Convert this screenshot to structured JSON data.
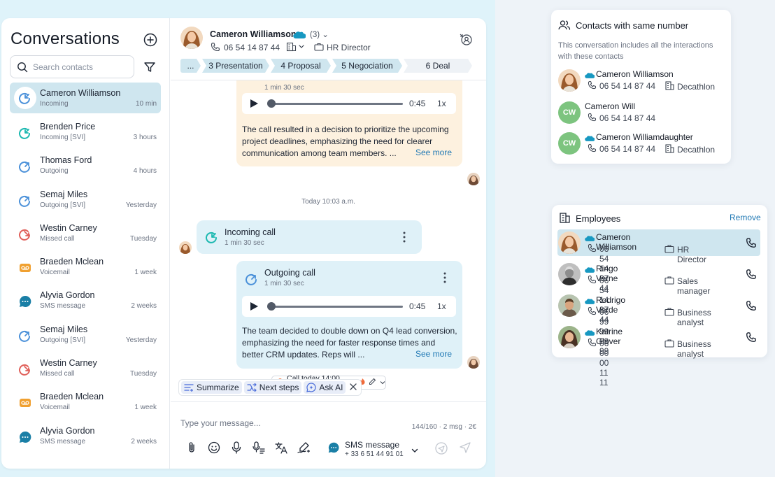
{
  "sidebar": {
    "title": "Conversations",
    "search_placeholder": "Search contacts",
    "conversations": [
      {
        "name": "Cameron Williamson",
        "type": "Incoming",
        "time": "10 min",
        "icon": "incoming-call-icon",
        "active": true
      },
      {
        "name": "Brenden Price",
        "type": "Incoming [SVI]",
        "time": "3 hours",
        "icon": "incoming-call-icon"
      },
      {
        "name": "Thomas Ford",
        "type": "Outgoing",
        "time": "4 hours",
        "icon": "outgoing-call-icon"
      },
      {
        "name": "Semaj Miles",
        "type": "Outgoing [SVI]",
        "time": "Yesterday",
        "icon": "outgoing-call-icon"
      },
      {
        "name": "Westin Carney",
        "type": "Missed call",
        "time": "Tuesday",
        "icon": "missed-call-icon"
      },
      {
        "name": "Braeden Mclean",
        "type": "Voicemail",
        "time": "1 week",
        "icon": "voicemail-icon"
      },
      {
        "name": "Alyvia Gordon",
        "type": "SMS message",
        "time": "2 weeks",
        "icon": "sms-icon"
      },
      {
        "name": "Semaj Miles",
        "type": "Outgoing [SVI]",
        "time": "Yesterday",
        "icon": "outgoing-call-icon"
      },
      {
        "name": "Westin Carney",
        "type": "Missed call",
        "time": "Tuesday",
        "icon": "missed-call-icon"
      },
      {
        "name": "Braeden Mclean",
        "type": "Voicemail",
        "time": "1 week",
        "icon": "voicemail-icon"
      },
      {
        "name": "Alyvia Gordon",
        "type": "SMS message",
        "time": "2 weeks",
        "icon": "sms-icon"
      }
    ]
  },
  "header": {
    "name": "Cameron Williamson",
    "count": "(3)",
    "phone": "06 54 14 87 44",
    "role": "HR Director",
    "pipeline": [
      {
        "label": "..."
      },
      {
        "label": "3 Presentation"
      },
      {
        "label": "4 Proposal"
      },
      {
        "label": "5 Negociation"
      },
      {
        "label": "6 Deal"
      }
    ]
  },
  "chat": {
    "first_call": {
      "duration": "1 min 30 sec",
      "time": "0:45",
      "speed": "1x",
      "summary": "The call resulted in a decision to prioritize the upcoming project deadlines, emphasizing the need for clearer communication among team  members. ...",
      "see_more": "See more"
    },
    "date_divider": "Today 10:03 a.m.",
    "incoming": {
      "title": "Incoming call",
      "duration": "1 min 30 sec"
    },
    "outgoing": {
      "title": "Outgoing call",
      "duration": "1 min 30 sec",
      "time": "0:45",
      "speed": "1x",
      "summary": "The team decided to double down on Q4 lead conversion, emphasizing the need for faster response times and better CRM updates. Reps will ...",
      "see_more": "See more"
    },
    "reminder": "Call today 14:00 p.m."
  },
  "ai_actions": [
    "Summarize",
    "Next steps",
    "Ask AI"
  ],
  "composer": {
    "placeholder": "Type your message...",
    "counter": "144/160 · 2 msg · 2€",
    "channel_label": "SMS message",
    "channel_number": "+ 33 6 51 44 91 01"
  },
  "contacts_panel": {
    "title": "Contacts with same number",
    "description": "This conversation includes all the interactions with these contacts",
    "contacts": [
      {
        "name": "Cameron Williamson",
        "phone": "06 54 14 87 44",
        "company": "Decathlon",
        "initials": ""
      },
      {
        "name": "Cameron Will",
        "phone": "06 54 14 87 44",
        "company": "",
        "initials": "CW"
      },
      {
        "name": "Cameron Williamdaughter",
        "phone": "06 54 14 87 44",
        "company": "Decathlon",
        "initials": "CW"
      }
    ]
  },
  "employees_panel": {
    "title": "Employees",
    "remove_label": "Remove",
    "employees": [
      {
        "name": "Cameron Williamson",
        "phone": "06 54 14 87 44",
        "role": "HR Director"
      },
      {
        "name": "Ringo Verne",
        "phone": "06 54 14 87 44",
        "role": "Sales manager"
      },
      {
        "name": "Rodrigo Verde",
        "phone": "06 99 99 99 99",
        "role": "Business analyst"
      },
      {
        "name": "Katrine Glover",
        "phone": "06 00 00 11 11",
        "role": "Business analyst"
      }
    ]
  },
  "colors": {
    "accent": "#1f78b4",
    "active_bg": "#cfe6ef",
    "salesforce": "#1798c1",
    "incoming": "#1bb8b0",
    "outgoing": "#4a90d9",
    "missed": "#e0605a",
    "voicemail": "#f0a030",
    "sms": "#1a7fa6"
  }
}
